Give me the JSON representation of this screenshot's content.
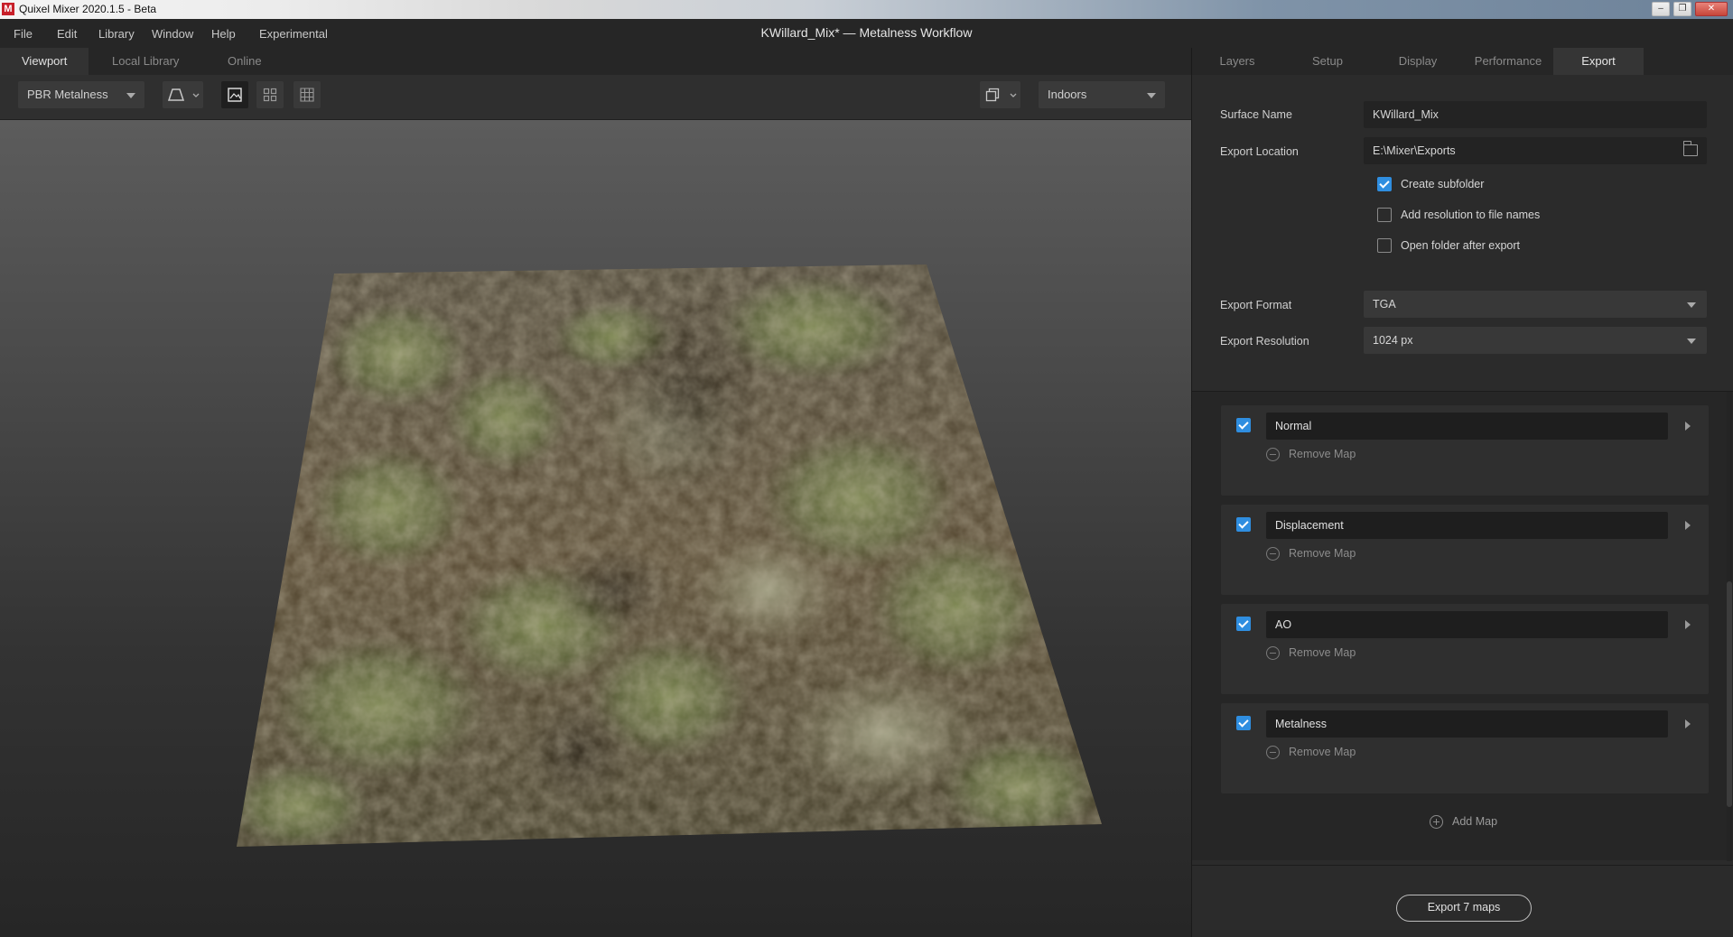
{
  "window": {
    "title": "Quixel Mixer 2020.1.5 - Beta",
    "app_icon": "M",
    "minimize_icon": "minimize-icon",
    "maximize_icon": "restore-icon",
    "close_icon": "close-icon"
  },
  "menu": {
    "items": [
      "File",
      "Edit",
      "Library",
      "Window",
      "Help",
      "Experimental"
    ],
    "document_title": "KWillard_Mix* — Metalness Workflow"
  },
  "left_tabs": [
    {
      "label": "Viewport",
      "active": true
    },
    {
      "label": "Local Library",
      "active": false
    },
    {
      "label": "Online",
      "active": false
    }
  ],
  "toolbar": {
    "shading_mode": "PBR Metalness",
    "environment": "Indoors",
    "icons": [
      "trapezoid-view-icon",
      "image-icon",
      "grid-2x2-icon",
      "grid-3x3-icon",
      "cube-icon"
    ]
  },
  "right_tabs": [
    {
      "label": "Layers",
      "active": false
    },
    {
      "label": "Setup",
      "active": false
    },
    {
      "label": "Display",
      "active": false
    },
    {
      "label": "Performance",
      "active": false
    },
    {
      "label": "Export",
      "active": true
    }
  ],
  "export": {
    "surface_name_label": "Surface Name",
    "surface_name_value": "KWillard_Mix",
    "export_location_label": "Export Location",
    "export_location_value": "E:\\Mixer\\Exports",
    "options": [
      {
        "label": "Create subfolder",
        "checked": true
      },
      {
        "label": "Add resolution to file names",
        "checked": false
      },
      {
        "label": "Open folder after export",
        "checked": false
      }
    ],
    "format_label": "Export Format",
    "format_value": "TGA",
    "resolution_label": "Export Resolution",
    "resolution_value": "1024 px",
    "maps": [
      {
        "name": "Normal",
        "checked": true,
        "remove_label": "Remove Map"
      },
      {
        "name": "Displacement",
        "checked": true,
        "remove_label": "Remove Map"
      },
      {
        "name": "AO",
        "checked": true,
        "remove_label": "Remove Map"
      },
      {
        "name": "Metalness",
        "checked": true,
        "remove_label": "Remove Map"
      }
    ],
    "add_map_label": "Add Map",
    "export_button_label": "Export 7 maps"
  },
  "colors": {
    "accent_blue": "#2f8ee0",
    "panel_bg": "#2b2b2b",
    "title_bar_red": "#c8202a"
  }
}
